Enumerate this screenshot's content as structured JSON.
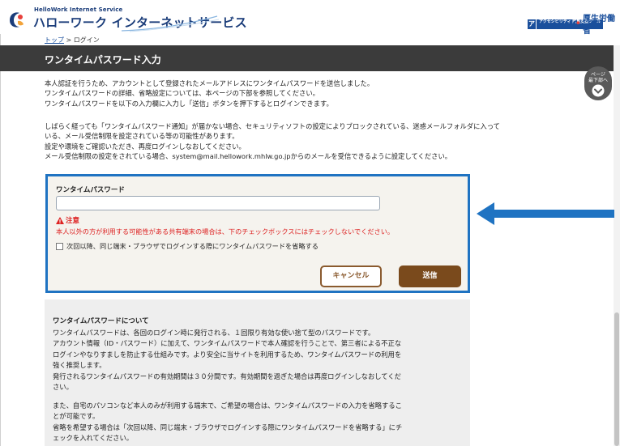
{
  "header": {
    "logo_sub": "HelloWork Internet Service",
    "logo_main": "ハローワーク インターネットサービス",
    "badge_left": "ア",
    "badge_text": "アクセシビリティ 閲覧支援ツール",
    "ministry": "厚生労働省"
  },
  "breadcrumb": {
    "top_link": "トップ",
    "current": "ログイン",
    "separator": " > "
  },
  "page_title": "ワンタイムパスワード入力",
  "page_jump": {
    "line1": "ページ",
    "line2": "最下部へ"
  },
  "intro": {
    "p1": [
      "本人認証を行うため、アカウントとして登録されたメールアドレスにワンタイムパスワードを送信しました。",
      "ワンタイムパスワードの詳細、省略設定については、本ページの下部を参照してください。",
      "ワンタイムパスワードを以下の入力欄に入力し「送信」ボタンを押下するとログインできます。"
    ],
    "p2": [
      "しばらく経っても「ワンタイムパスワード通知」が届かない場合、セキュリティソフトの設定によりブロックされている、迷惑メールフォルダに入って",
      "いる、メール受信制限を設定されている等の可能性があります。",
      "設定や環境をご確認いただき、再度ログインしなおしてください。",
      "メール受信制限の設定をされている場合、system@mail.hellowork.mhlw.go.jpからのメールを受信できるように設定してください。"
    ]
  },
  "form": {
    "otp_label": "ワンタイムパスワード",
    "otp_value": "",
    "otp_placeholder": "",
    "caution_title": "注意",
    "caution_text": "本人以外の方が利用する可能性がある共有端末の場合は、下のチェックボックスにはチェックしないでください。",
    "skip_checkbox_label": "次回以降、同じ端末・ブラウザでログインする際にワンタイムパスワードを省略する",
    "cancel_label": "キャンセル",
    "submit_label": "送信"
  },
  "info": {
    "heading": "ワンタイムパスワードについて",
    "p1": [
      "ワンタイムパスワードは、各回のログイン時に発行される、１回限り有効な使い捨て型のパスワードです。",
      "アカウント情報（ID・パスワード）に加えて、ワンタイムパスワードで本人確認を行うことで、第三者による不正な",
      "ログインやなりすましを防止する仕組みです。より安全に当サイトを利用するため、ワンタイムパスワードの利用を",
      "強く推奨します。",
      "発行されるワンタイムパスワードの有効期間は３０分間です。有効期間を過ぎた場合は再度ログインしなおしてくだ",
      "さい。"
    ],
    "p2": [
      "また、自宅のパソコンなど本人のみが利用する端末で、ご希望の場合は、ワンタイムパスワードの入力を省略するこ",
      "とが可能です。",
      "省略を希望する場合は「次回以降、同じ端末・ブラウザでログインする際にワンタイムパスワードを省略する」にチ",
      "ェックを入れてください。"
    ]
  },
  "colors": {
    "brand": "#1b3d7a",
    "highlight_border": "#1f73c2",
    "arrow": "#1f73c2",
    "caution": "#dd2222",
    "submit_bg": "#7a4a1c",
    "title_bar": "#3b3b3b"
  },
  "icons": {
    "logo": "hellowork-logo-icon",
    "chevron": "chevron-down-icon",
    "warning": "warning-icon",
    "arrow": "arrow-left-icon"
  }
}
